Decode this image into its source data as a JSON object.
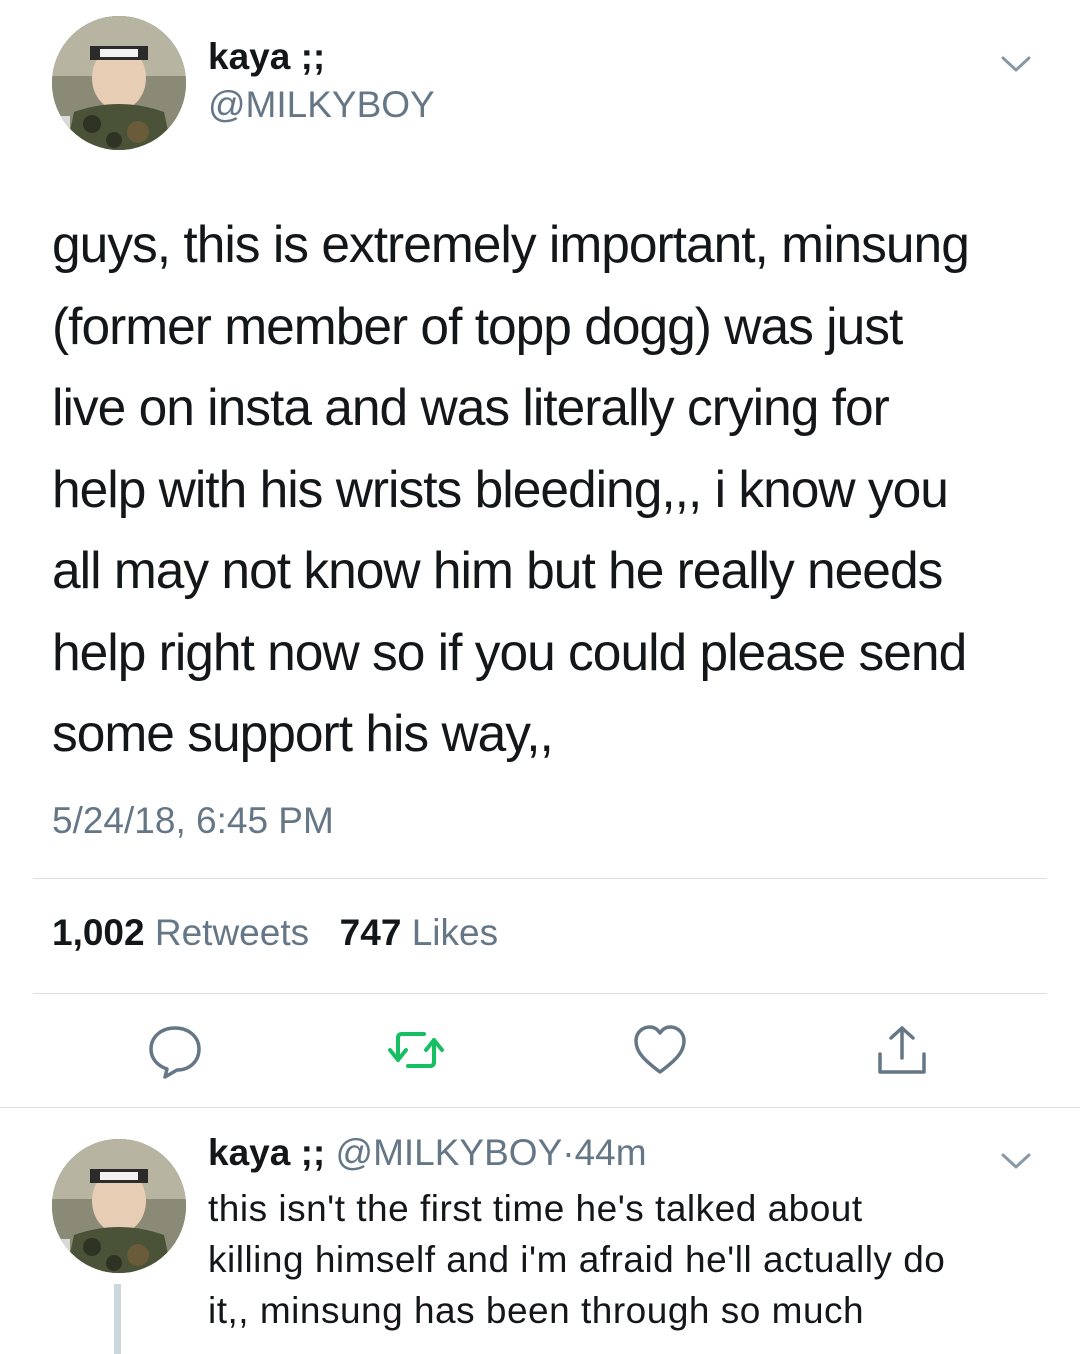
{
  "tweet": {
    "author_name": "kaya ;;",
    "author_handle": "@MILKYBOY",
    "text_lines": [
      "guys, this is extremely important, minsung",
      "(former member of topp dogg) was just",
      "live on insta and was literally crying for",
      "help with his wrists bleeding,,, i know you",
      "all may not know him but he really needs",
      "help right now so if you could please send",
      "some support his way,,"
    ],
    "timestamp": "5/24/18, 6:45 PM",
    "stats": {
      "retweets_count": "1,002",
      "retweets_label": "Retweets",
      "likes_count": "747",
      "likes_label": "Likes"
    },
    "actions": {
      "reply_icon": "speech-bubble",
      "retweet_icon": "retweet-arrows",
      "like_icon": "heart-outline",
      "share_icon": "share-upload"
    }
  },
  "reply": {
    "author_name": "kaya ;;",
    "author_handle": "@MILKYBOY",
    "separator": "·",
    "time_ago": "44m",
    "text_lines": [
      "this isn't the first time he's talked about",
      "killing himself and i'm afraid he'll actually do",
      "it,, minsung has been through so much"
    ]
  },
  "colors": {
    "text_primary": "#14171a",
    "text_secondary": "#657786",
    "retweet_green": "#17bf63",
    "icon_gray": "#657786",
    "divider": "#dcdfe3",
    "thread_line": "#ccd6dd"
  }
}
